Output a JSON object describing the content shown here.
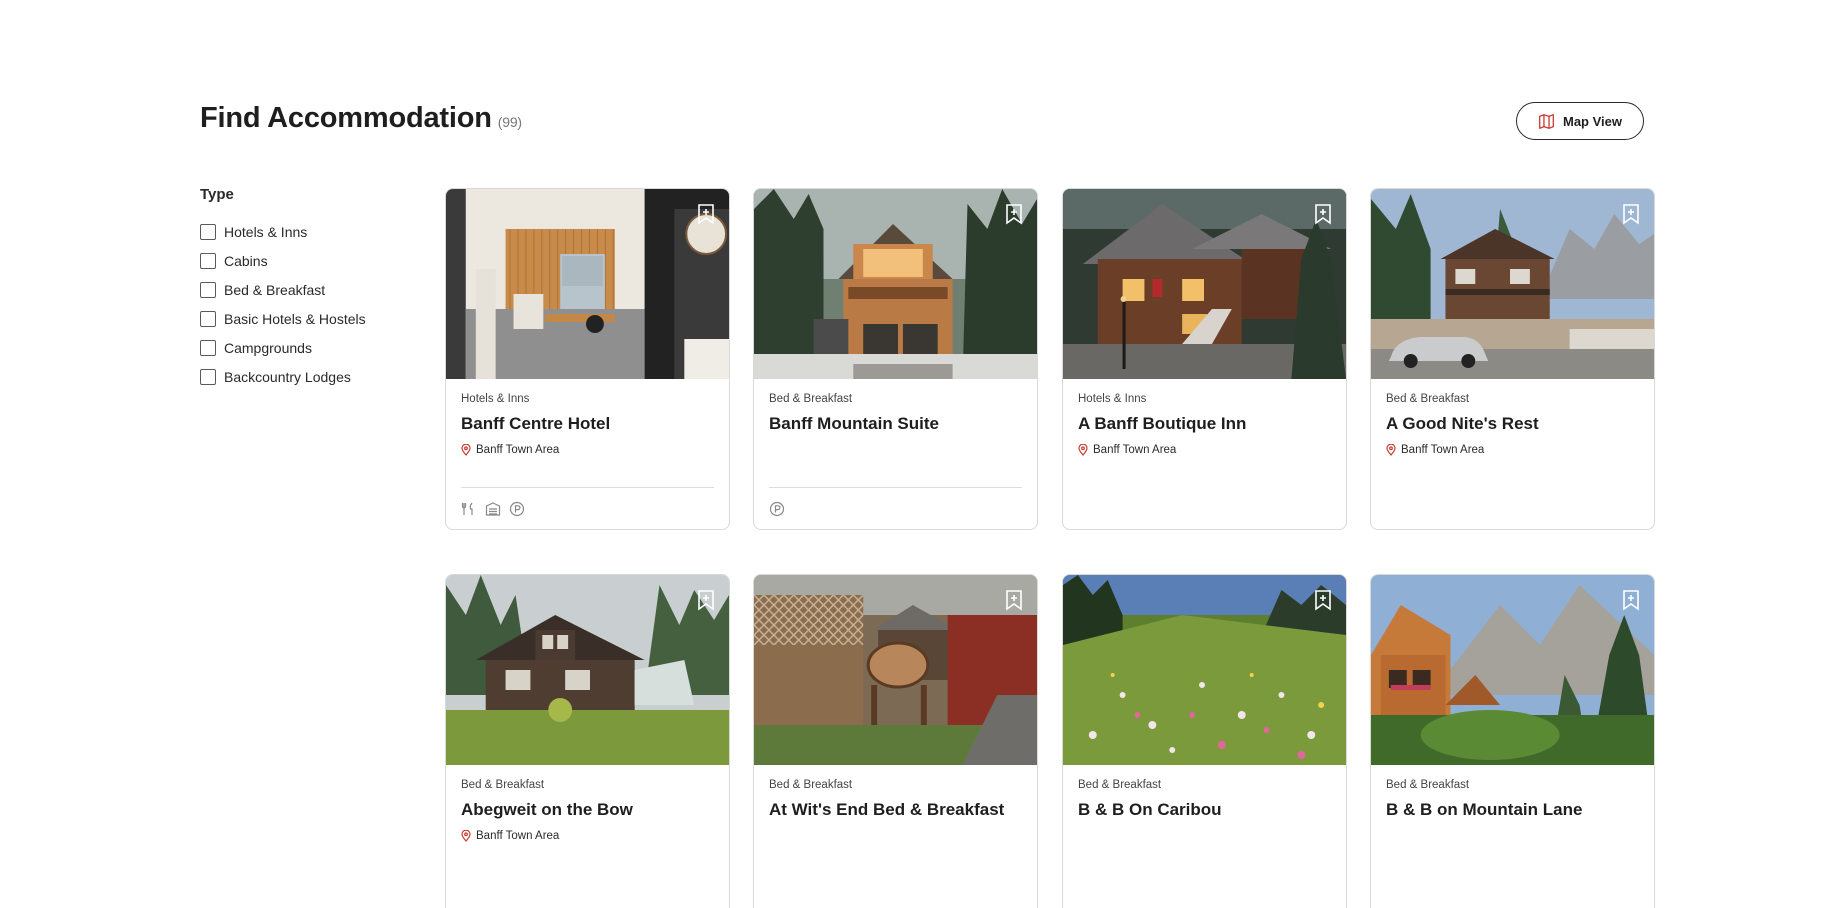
{
  "header": {
    "title": "Find Accommodation",
    "count": "(99)",
    "map_button_label": "Map View"
  },
  "filters": {
    "title": "Type",
    "options": [
      "Hotels & Inns",
      "Cabins",
      "Bed & Breakfast",
      "Basic Hotels & Hostels",
      "Campgrounds",
      "Backcountry Lodges"
    ]
  },
  "listings": [
    {
      "type": "Hotels & Inns",
      "name": "Banff Centre Hotel",
      "location": "Banff Town Area",
      "amenities": [
        "restaurant-icon",
        "parking-garage-icon",
        "parking-icon"
      ]
    },
    {
      "type": "Bed & Breakfast",
      "name": "Banff Mountain Suite",
      "location": "",
      "amenities": [
        "parking-icon"
      ]
    },
    {
      "type": "Hotels & Inns",
      "name": "A Banff Boutique Inn",
      "location": "Banff Town Area",
      "amenities": []
    },
    {
      "type": "Bed & Breakfast",
      "name": "A Good Nite's Rest",
      "location": "Banff Town Area",
      "amenities": []
    },
    {
      "type": "Bed & Breakfast",
      "name": "Abegweit on the Bow",
      "location": "Banff Town Area",
      "amenities": []
    },
    {
      "type": "Bed & Breakfast",
      "name": "At Wit's End Bed & Breakfast",
      "location": "",
      "amenities": []
    },
    {
      "type": "Bed & Breakfast",
      "name": "B & B On Caribou",
      "location": "",
      "amenities": []
    },
    {
      "type": "Bed & Breakfast",
      "name": "B & B on Mountain Lane",
      "location": "",
      "amenities": []
    }
  ],
  "colors": {
    "accent_pin": "#c8372d",
    "text": "#1e1e1e",
    "border": "#d9d9d9"
  }
}
